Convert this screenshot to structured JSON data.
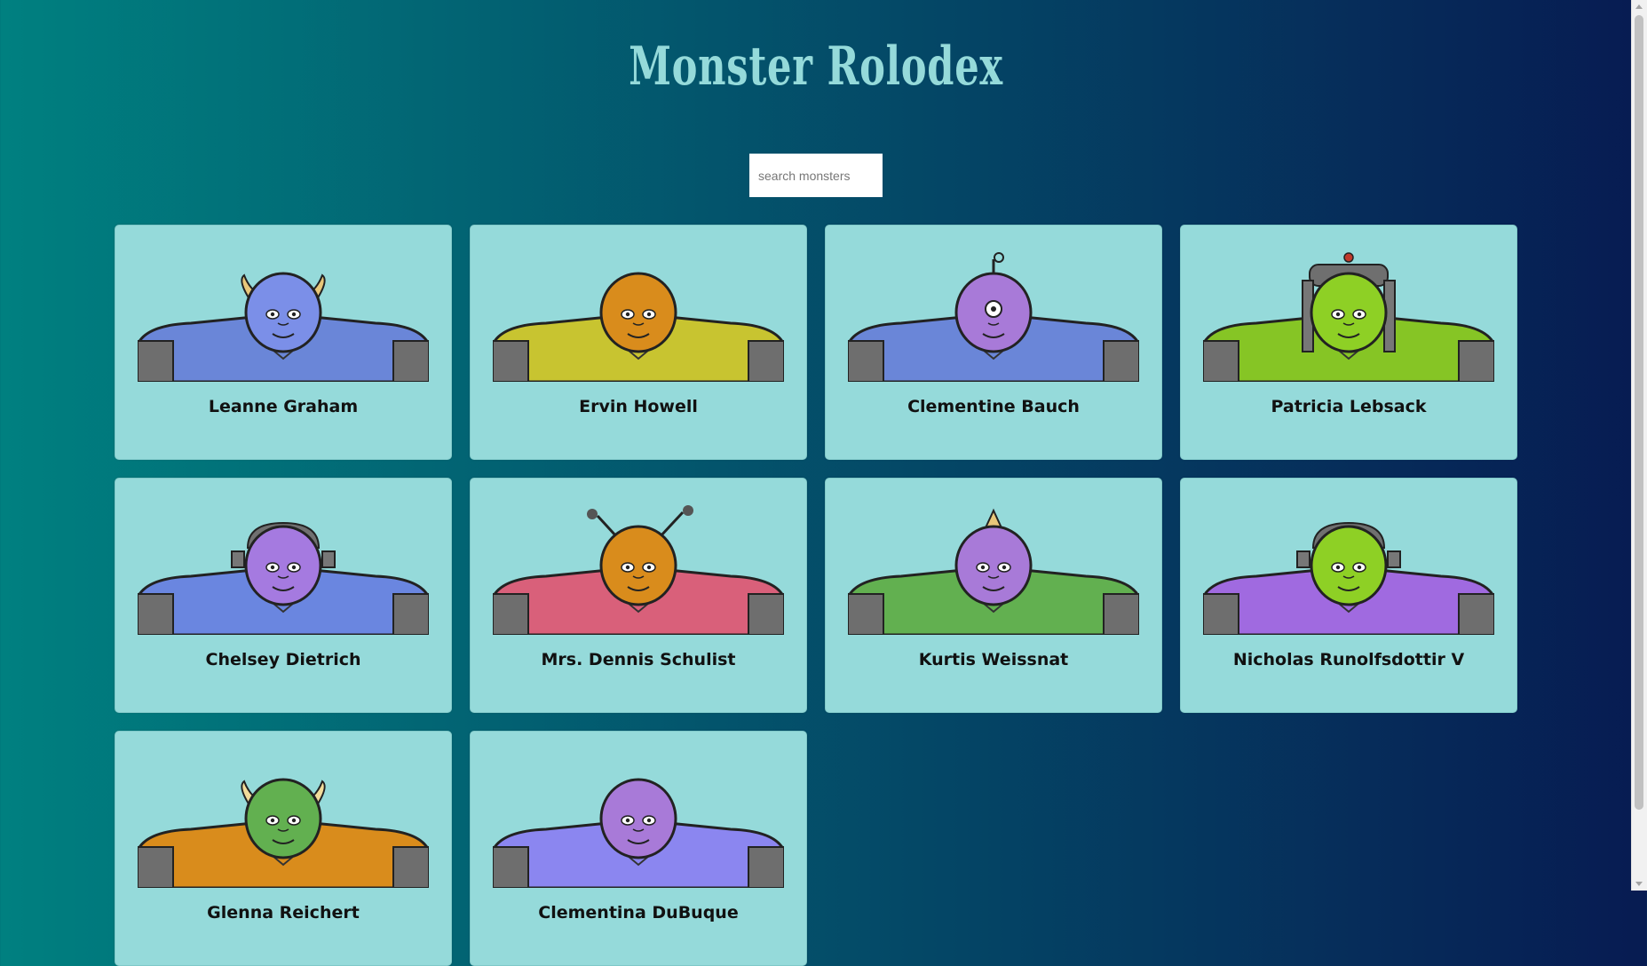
{
  "app": {
    "title": "Monster Rolodex"
  },
  "search": {
    "placeholder": "search monsters",
    "value": ""
  },
  "monsters": [
    {
      "name": "Leanne Graham",
      "skin": "#7b8fe8",
      "body": "#6a86d8",
      "feature": "horns",
      "horn": "#e8c77a",
      "eye": "single-pair"
    },
    {
      "name": "Ervin Howell",
      "skin": "#d98c1c",
      "body": "#c8c430",
      "feature": "none",
      "eye": "pair"
    },
    {
      "name": "Clementine Bauch",
      "skin": "#a87ad8",
      "body": "#6a86d8",
      "feature": "antenna",
      "eye": "cyclops"
    },
    {
      "name": "Patricia Lebsack",
      "skin": "#8ed025",
      "body": "#86c525",
      "feature": "helmet",
      "eye": "pair"
    },
    {
      "name": "Chelsey Dietrich",
      "skin": "#a57ae0",
      "body": "#6a86e0",
      "feature": "helmet-small",
      "eye": "pair"
    },
    {
      "name": "Mrs. Dennis Schulist",
      "skin": "#d98c1c",
      "body": "#d9607a",
      "feature": "antennae",
      "eye": "pair"
    },
    {
      "name": "Kurtis Weissnat",
      "skin": "#a87ad8",
      "body": "#62b050",
      "feature": "horn-single",
      "horn": "#e8c77a",
      "eye": "pair"
    },
    {
      "name": "Nicholas Runolfsdottir V",
      "skin": "#8ed025",
      "body": "#a06ae0",
      "feature": "helmet-small",
      "eye": "pair"
    },
    {
      "name": "Glenna Reichert",
      "skin": "#62b050",
      "body": "#d98c1c",
      "feature": "horns",
      "horn": "#f2dc9a",
      "eye": "pair"
    },
    {
      "name": "Clementina DuBuque",
      "skin": "#a87ad8",
      "body": "#8b86f0",
      "feature": "none",
      "eye": "pair"
    }
  ]
}
